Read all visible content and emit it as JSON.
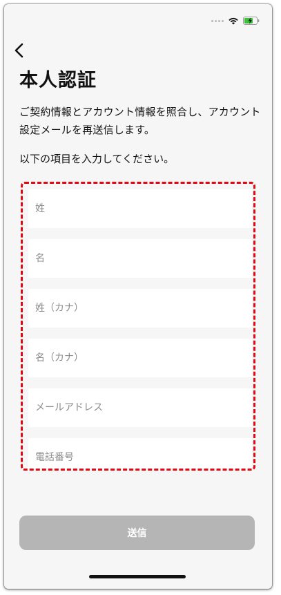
{
  "status_bar": {
    "wifi_icon": "wifi-icon",
    "battery_icon": "battery-charging-icon",
    "battery_color": "#3cc13b"
  },
  "header": {
    "back_icon": "chevron-left-icon",
    "title": "本人認証"
  },
  "description": "ご契約情報とアカウント情報を照合し、アカウント設定メールを再送信します。",
  "instruction": "以下の項目を入力してください。",
  "form": {
    "highlight_color": "#e30613",
    "fields": [
      {
        "placeholder": "姓",
        "value": ""
      },
      {
        "placeholder": "名",
        "value": ""
      },
      {
        "placeholder": "姓（カナ）",
        "value": ""
      },
      {
        "placeholder": "名（カナ）",
        "value": ""
      },
      {
        "placeholder": "メールアドレス",
        "value": ""
      },
      {
        "placeholder": "電話番号",
        "value": ""
      }
    ]
  },
  "submit": {
    "label": "送信",
    "state": "disabled",
    "color": "#b5b5b5"
  }
}
